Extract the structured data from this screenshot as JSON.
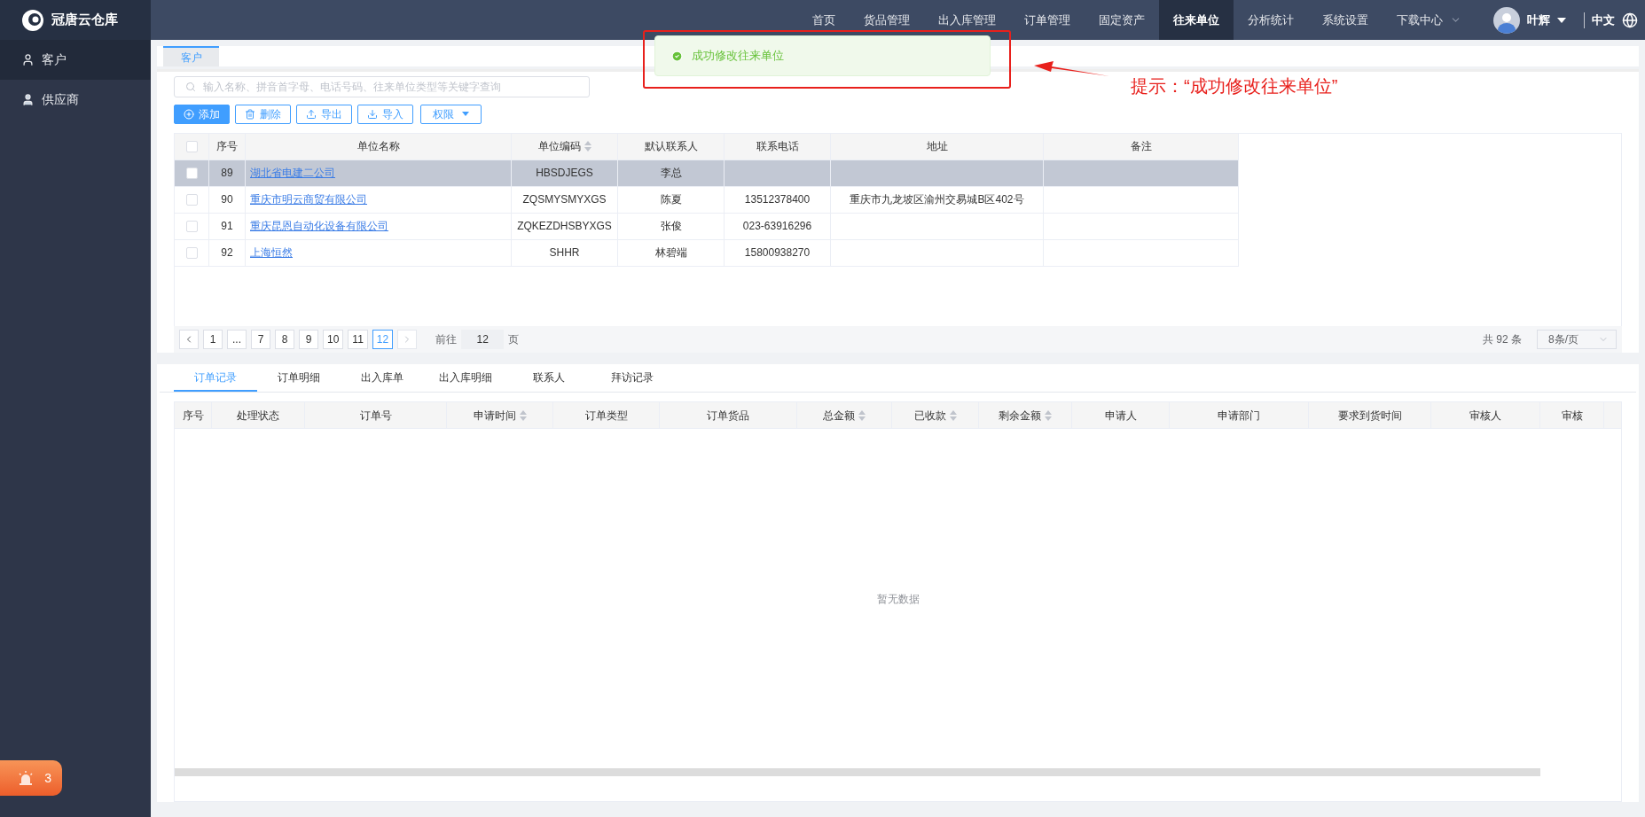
{
  "app": {
    "logo_text": "冠唐云仓库"
  },
  "nav": {
    "items": [
      {
        "label": "首页",
        "selected": false,
        "dropdown": false
      },
      {
        "label": "货品管理",
        "selected": false,
        "dropdown": false
      },
      {
        "label": "出入库管理",
        "selected": false,
        "dropdown": false
      },
      {
        "label": "订单管理",
        "selected": false,
        "dropdown": false
      },
      {
        "label": "固定资产",
        "selected": false,
        "dropdown": false
      },
      {
        "label": "往来单位",
        "selected": true,
        "dropdown": false
      },
      {
        "label": "分析统计",
        "selected": false,
        "dropdown": false
      },
      {
        "label": "系统设置",
        "selected": false,
        "dropdown": false
      },
      {
        "label": "下载中心",
        "selected": false,
        "dropdown": true
      }
    ],
    "user": {
      "name": "叶辉"
    },
    "language": "中文"
  },
  "sidebar": {
    "items": [
      {
        "label": "客户",
        "selected": true
      },
      {
        "label": "供应商",
        "selected": false
      }
    ]
  },
  "page_tabs": [
    {
      "label": "客户",
      "selected": true
    }
  ],
  "search": {
    "placeholder": "输入名称、拼音首字母、电话号码、往来单位类型等关键字查询"
  },
  "toolbar": [
    {
      "label": "添加",
      "kind": "primary"
    },
    {
      "label": "删除",
      "kind": "plain"
    },
    {
      "label": "导出",
      "kind": "plain"
    },
    {
      "label": "导入",
      "kind": "plain"
    },
    {
      "label": "权限",
      "kind": "dropdown"
    }
  ],
  "table": {
    "all_checked": false,
    "columns": [
      {
        "label": "序号",
        "sortable": false
      },
      {
        "label": "单位名称",
        "sortable": false
      },
      {
        "label": "单位编码",
        "sortable": true
      },
      {
        "label": "默认联系人",
        "sortable": false
      },
      {
        "label": "联系电话",
        "sortable": false
      },
      {
        "label": "地址",
        "sortable": false
      },
      {
        "label": "备注",
        "sortable": false
      }
    ],
    "rows": [
      {
        "index": "89",
        "name": "湖北省电建二公司",
        "code": "HBSDJEGS",
        "contact": "李总",
        "selected": true,
        "checked": false
      },
      {
        "index": "90",
        "name": "重庆市明云商贸有限公司",
        "code": "ZQSMYSMYXGS",
        "contact": "陈夏",
        "phone": "13512378400",
        "address": "重庆市九龙坡区渝州交易城B区402号",
        "selected": false,
        "checked": false
      },
      {
        "index": "91",
        "name": "重庆昆恩自动化设备有限公司",
        "code": "ZQKEZDHSBYXGS",
        "contact": "张俊",
        "phone": "023-63916296",
        "selected": false,
        "checked": false
      },
      {
        "index": "92",
        "name": "上海恒然",
        "code": "SHHR",
        "contact": "林碧端",
        "phone": "15800938270",
        "selected": false,
        "checked": false
      }
    ]
  },
  "pagination": {
    "pages": [
      {
        "label": "1",
        "selected": false
      },
      {
        "label": "...",
        "selected": false
      },
      {
        "label": "7",
        "selected": false
      },
      {
        "label": "8",
        "selected": false
      },
      {
        "label": "9",
        "selected": false
      },
      {
        "label": "10",
        "selected": false
      },
      {
        "label": "11",
        "selected": false
      },
      {
        "label": "12",
        "selected": true
      }
    ],
    "goto_label": "前往",
    "goto_value": "12",
    "goto_suffix": "页",
    "total": "共 92 条",
    "page_size": "8条/页"
  },
  "detail_tabs": [
    {
      "label": "订单记录",
      "selected": true
    },
    {
      "label": "订单明细",
      "selected": false
    },
    {
      "label": "出入库单",
      "selected": false
    },
    {
      "label": "出入库明细",
      "selected": false
    },
    {
      "label": "联系人",
      "selected": false
    },
    {
      "label": "拜访记录",
      "selected": false
    }
  ],
  "detail_table": {
    "columns": [
      {
        "label": "序号",
        "sortable": false
      },
      {
        "label": "处理状态",
        "sortable": false
      },
      {
        "label": "订单号",
        "sortable": false
      },
      {
        "label": "申请时间",
        "sortable": true
      },
      {
        "label": "订单类型",
        "sortable": false
      },
      {
        "label": "订单货品",
        "sortable": false
      },
      {
        "label": "总金额",
        "sortable": true
      },
      {
        "label": "已收款",
        "sortable": true
      },
      {
        "label": "剩余金额",
        "sortable": true
      },
      {
        "label": "申请人",
        "sortable": false
      },
      {
        "label": "申请部门",
        "sortable": false
      },
      {
        "label": "要求到货时间",
        "sortable": false
      },
      {
        "label": "审核人",
        "sortable": false
      },
      {
        "label": "审核",
        "sortable": false
      }
    ],
    "empty_text": "暂无数据"
  },
  "toast": {
    "message": "成功修改往来单位"
  },
  "annotation": {
    "text": "提示：“成功修改往来单位”"
  },
  "alarm": {
    "count": "3"
  }
}
